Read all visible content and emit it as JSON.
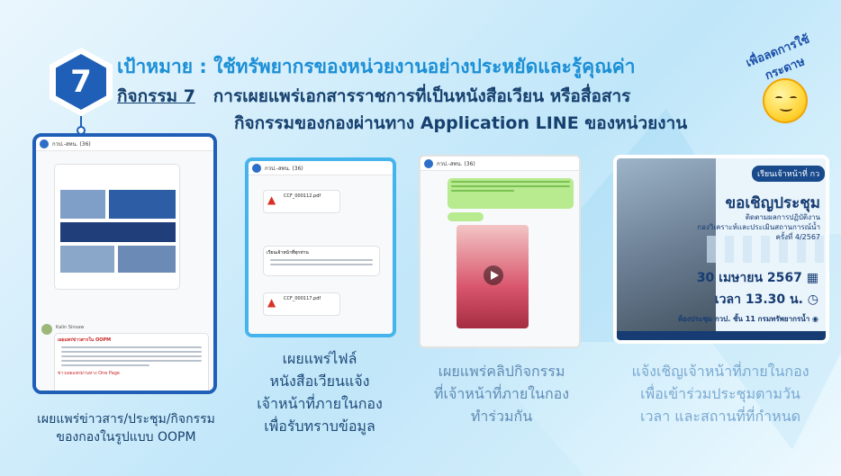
{
  "header": {
    "number": "7",
    "goal": "เป้าหมาย : ใช้ทรัพยากรของหน่วยงานอย่างประหยัดและรู้คุณค่า",
    "activity_label": "กิจกรรม 7",
    "activity_line1": "การเผยแพร่เอกสารราชการที่เป็นหนังสือเวียน หรือสื่อสาร",
    "activity_line2": "กิจกรรมของกองผ่านทาง Application LINE ของหน่วยงาน"
  },
  "mascot": {
    "text": "เพื่อลดการใช้กระดาษ"
  },
  "cards": {
    "card1": {
      "chat_title": "กวป.-สทน. (36)",
      "sender": "Kalin Sinsaw",
      "msg": "เผยแพร่ข่าวสารใน OOPM",
      "note": "ข่าวเผยแพร่ผ่านทาง One Page"
    },
    "card2": {
      "chat_title": "กวป.-สทน. (36)",
      "file1": "CCF_000112.pdf",
      "file2": "CCF_000117.pdf",
      "msg": "เรียนเจ้าหน้าที่ทุกท่าน"
    },
    "card3": {
      "chat_title": "กวป.-สทน. (36)"
    },
    "card4": {
      "tag": "เรียนเจ้าหน้าที่ กว",
      "title": "ขอเชิญประชุม",
      "sub1": "ติดตามผลการปฏิบัติงาน",
      "sub2": "กองวิเคราะห์และประเมินสถานการณ์น้ำ",
      "sub3": "ครั้งที่ 4/2567",
      "date": "30 เมษายน 2567",
      "time": "เวลา 13.30 น.",
      "room": "ห้องประชุม กวป. ชั้น 11 กรมทรัพยากรน้ำ"
    }
  },
  "captions": {
    "cap1_l1": "เผยแพร่ข่าวสาร/ประชุม/กิจกรรม",
    "cap1_l2": "ของกองในรูปแบบ OOPM",
    "cap2_l1": "เผยแพร่ไฟล์",
    "cap2_l2": "หนังสือเวียนแจ้ง",
    "cap2_l3": "เจ้าหน้าที่ภายในกอง",
    "cap2_l4": "เพื่อรับทราบข้อมูล",
    "cap3_l1": "เผยแพร่คลิปกิจกรรม",
    "cap3_l2": "ที่เจ้าหน้าที่ภายในกอง",
    "cap3_l3": "ทำร่วมกัน",
    "cap4_l1": "แจ้งเชิญเจ้าหน้าที่ภายในกอง",
    "cap4_l2": "เพื่อเข้าร่วมประชุมตามวัน",
    "cap4_l3": "เวลา และสถานที่ที่กำหนด"
  }
}
